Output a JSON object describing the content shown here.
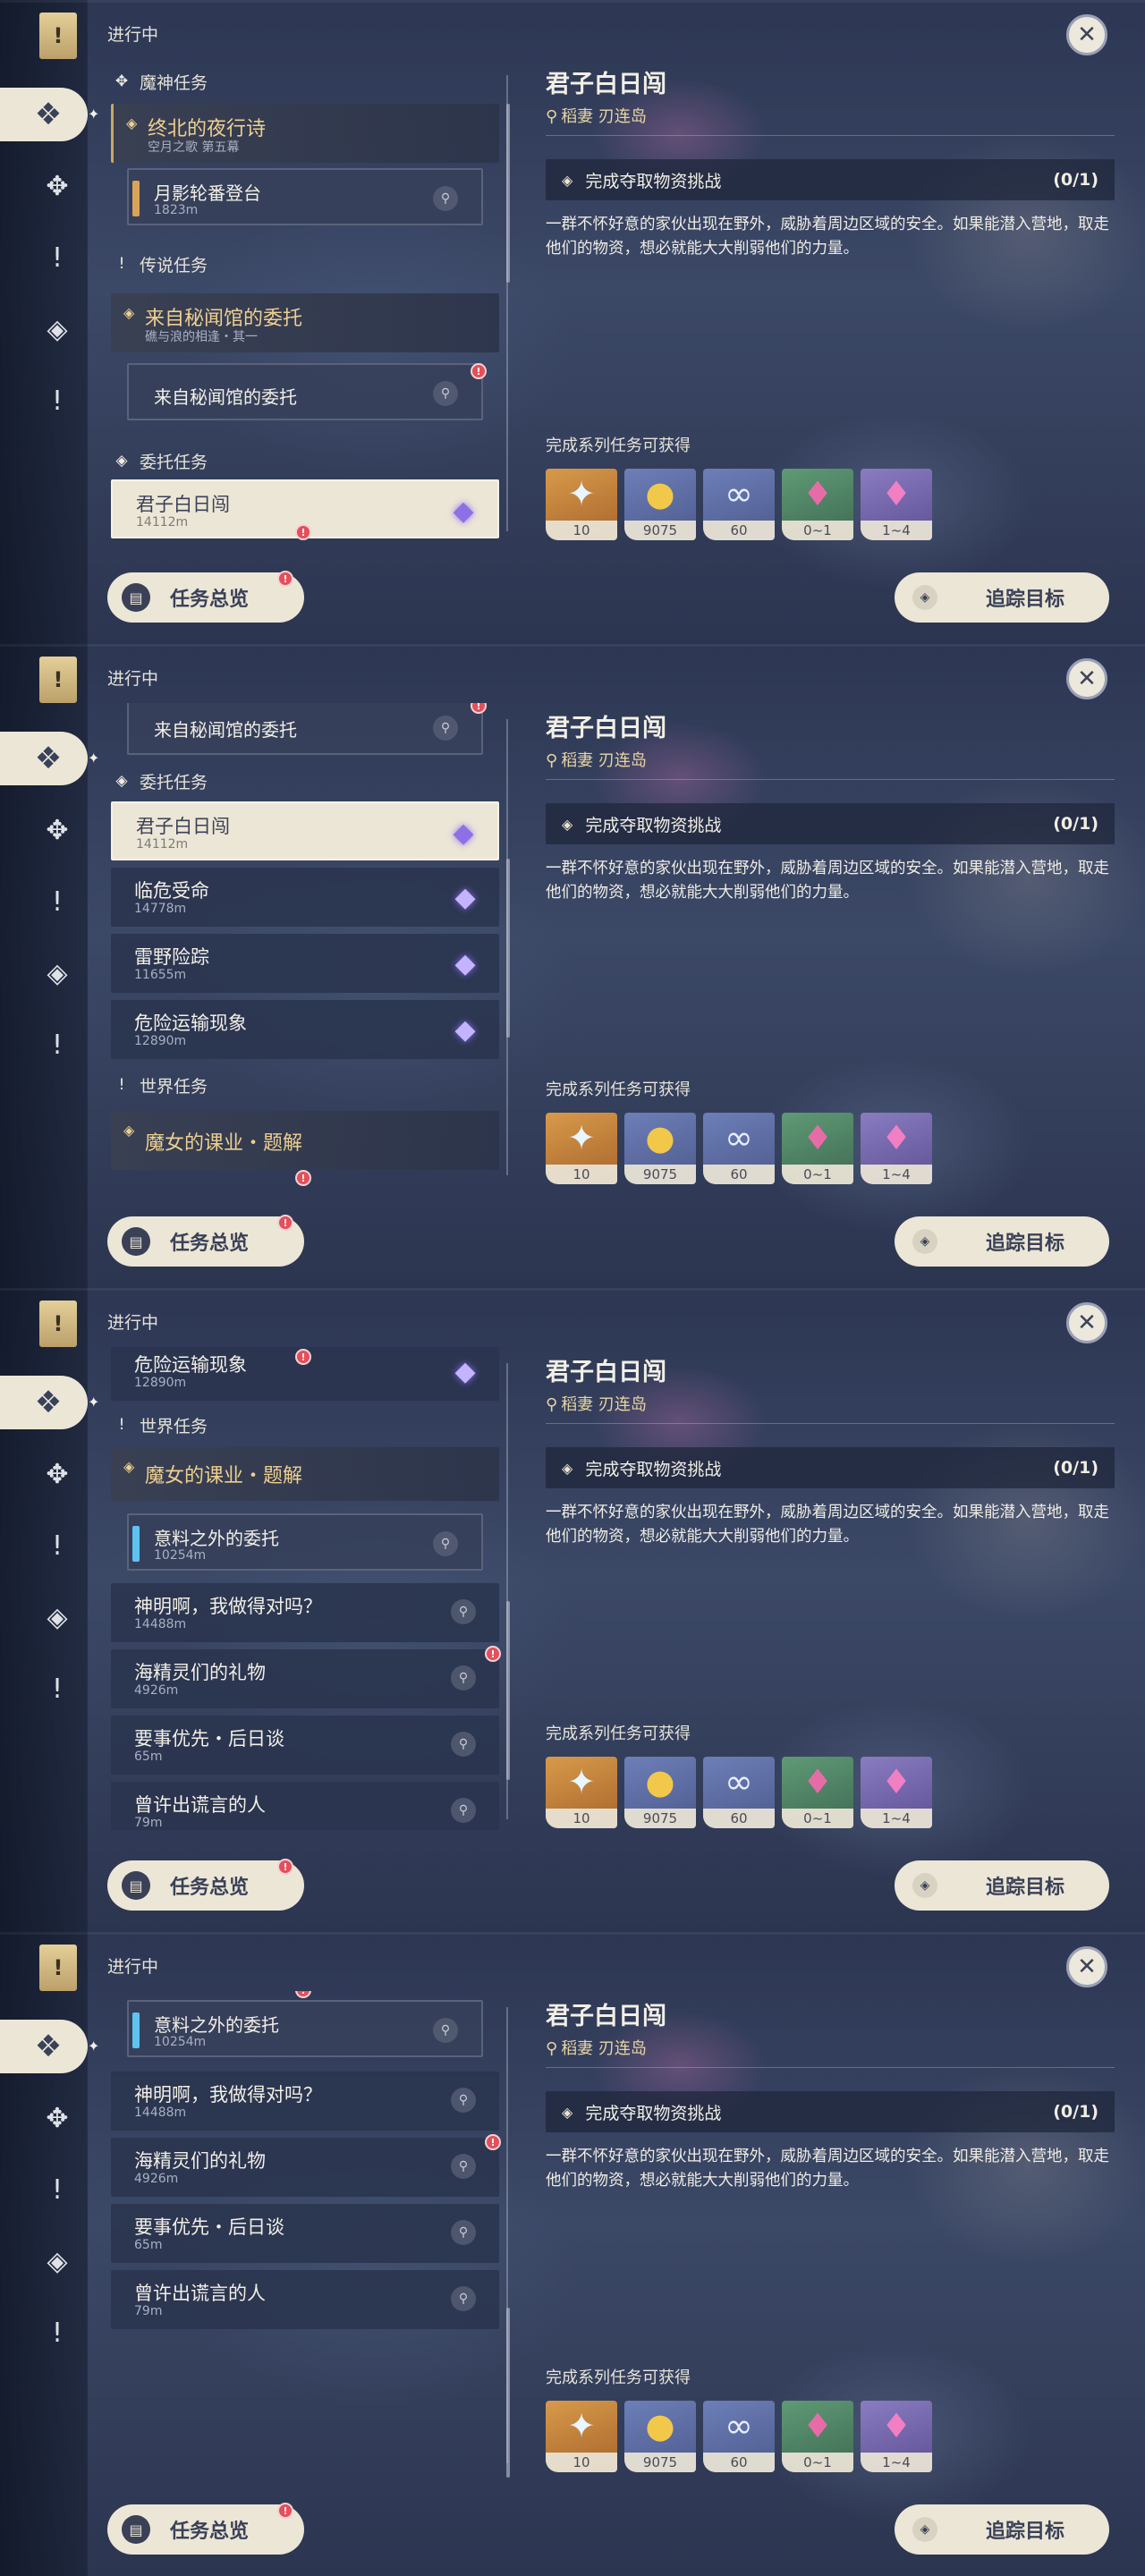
{
  "header": {
    "in_progress": "进行中",
    "close": "✕"
  },
  "rail": {
    "bookmark": "!",
    "icons": [
      "archon-diamond-icon",
      "wind-diamond-icon",
      "exclamation-icon",
      "compass-diamond-icon",
      "exclamation-icon"
    ]
  },
  "categories": {
    "archon": "魔神任务",
    "legend": "传说任务",
    "commission": "委托任务",
    "world": "世界任务"
  },
  "quests": {
    "archon_main": {
      "title": "终北的夜行诗",
      "subtitle": "空月之歌 第五幕"
    },
    "archon_sub": {
      "title": "月影轮番登台",
      "distance": "1823m"
    },
    "legend_main": {
      "title": "来自秘闻馆的委托",
      "subtitle": "礁与浪的相逢・其一"
    },
    "legend_sub": {
      "title": "来自秘闻馆的委托"
    },
    "comm1": {
      "title": "君子白日闯",
      "distance": "14112m"
    },
    "comm2": {
      "title": "临危受命",
      "distance": "14778m"
    },
    "comm3": {
      "title": "雷野险踪",
      "distance": "11655m"
    },
    "comm4": {
      "title": "危险运输现象",
      "distance": "12890m"
    },
    "world_main": {
      "title": "魔女的课业・题解"
    },
    "world_sub": {
      "title": "意料之外的委托",
      "distance": "10254m"
    },
    "w2": {
      "title": "神明啊，我做得对吗？",
      "distance": "14488m"
    },
    "w3": {
      "title": "海精灵们的礼物",
      "distance": "4926m"
    },
    "w4": {
      "title": "要事优先・后日谈",
      "distance": "65m"
    },
    "w5": {
      "title": "曾许出谎言的人",
      "distance": "79m"
    }
  },
  "detail": {
    "title": "君子白日闯",
    "location": "稻妻 刃连岛",
    "objective": "完成夺取物资挑战",
    "objective_count": "(0/1)",
    "description": "一群不怀好意的家伙出现在野外，威胁着周边区域的安全。如果能潜入营地，取走他们的物资，想必就能大大削弱他们的力量。",
    "rewards_title": "完成系列任务可获得",
    "rewards": [
      {
        "icon": "primogem-icon",
        "qty": "10"
      },
      {
        "icon": "mora-icon",
        "qty": "9075"
      },
      {
        "icon": "adventure-exp-icon",
        "qty": "60"
      },
      {
        "icon": "green-crystal-icon",
        "qty": "0~1"
      },
      {
        "icon": "purple-crystal-icon",
        "qty": "1~4"
      }
    ]
  },
  "buttons": {
    "overview": "任务总览",
    "track": "追踪目标"
  },
  "colors": {
    "selected_bg": "#ece6d6",
    "gold": "#eecf8f",
    "world_bar": "#5ec3f0",
    "archon_bar": "#d9a35a",
    "alert": "#e34f5a"
  }
}
